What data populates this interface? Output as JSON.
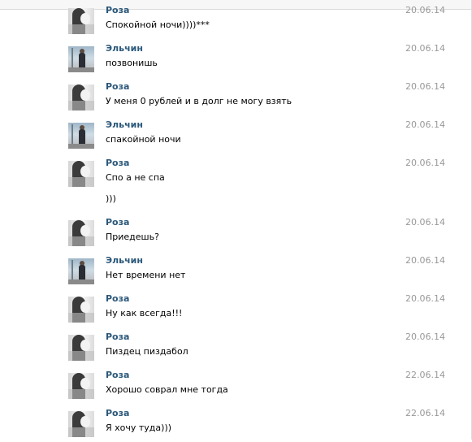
{
  "messages": [
    {
      "author": "Роза",
      "date": "20.06.14",
      "lines": [
        "Спокойной ночи))))***"
      ],
      "avatar": "rosa"
    },
    {
      "author": "Эльчин",
      "date": "20.06.14",
      "lines": [
        "позвонишь"
      ],
      "avatar": "elchin"
    },
    {
      "author": "Роза",
      "date": "20.06.14",
      "lines": [
        "У меня 0 рублей и в долг не могу взять"
      ],
      "avatar": "rosa"
    },
    {
      "author": "Эльчин",
      "date": "20.06.14",
      "lines": [
        "спакойной ночи"
      ],
      "avatar": "elchin"
    },
    {
      "author": "Роза",
      "date": "20.06.14",
      "lines": [
        "Спо а не спа",
        ")))"
      ],
      "avatar": "rosa"
    },
    {
      "author": "Роза",
      "date": "20.06.14",
      "lines": [
        "Приедешь?"
      ],
      "avatar": "rosa"
    },
    {
      "author": "Эльчин",
      "date": "20.06.14",
      "lines": [
        "Нет времени нет"
      ],
      "avatar": "elchin"
    },
    {
      "author": "Роза",
      "date": "20.06.14",
      "lines": [
        "Ну как всегда!!!"
      ],
      "avatar": "rosa"
    },
    {
      "author": "Роза",
      "date": "20.06.14",
      "lines": [
        "Пиздец пиздабол"
      ],
      "avatar": "rosa"
    },
    {
      "author": "Роза",
      "date": "22.06.14",
      "lines": [
        "Хорошо соврал мне тогда"
      ],
      "avatar": "rosa"
    },
    {
      "author": "Роза",
      "date": "22.06.14",
      "lines": [
        "Я хочу туда)))"
      ],
      "avatar": "rosa"
    }
  ]
}
